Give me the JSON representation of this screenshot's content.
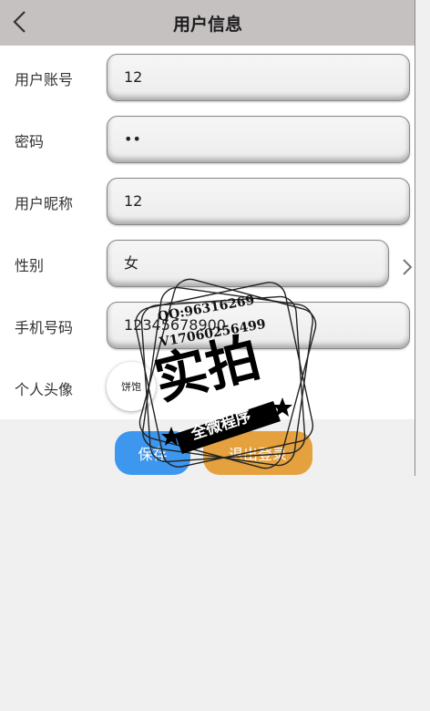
{
  "header": {
    "title": "用户信息"
  },
  "form": {
    "account": {
      "label": "用户账号",
      "value": "12"
    },
    "password": {
      "label": "密码",
      "value": "••"
    },
    "nickname": {
      "label": "用户昵称",
      "value": "12"
    },
    "gender": {
      "label": "性别",
      "value": "女"
    },
    "phone": {
      "label": "手机号码",
      "value": "12345678900"
    },
    "avatar": {
      "label": "个人头像",
      "thumb_text": "饼饱"
    }
  },
  "buttons": {
    "save": "保存",
    "logout": "退出登录"
  },
  "watermark": {
    "qq": "QQ:96316269",
    "wx": "V17060256499",
    "big": "实拍",
    "banner": "全微程序"
  },
  "colors": {
    "header_bg": "#c6c1c1",
    "save_btn": "#3d97ee",
    "logout_btn": "#e4a13d"
  },
  "icons": {
    "back": "chevron-left-icon",
    "gender_arrow": "chevron-right-icon"
  }
}
